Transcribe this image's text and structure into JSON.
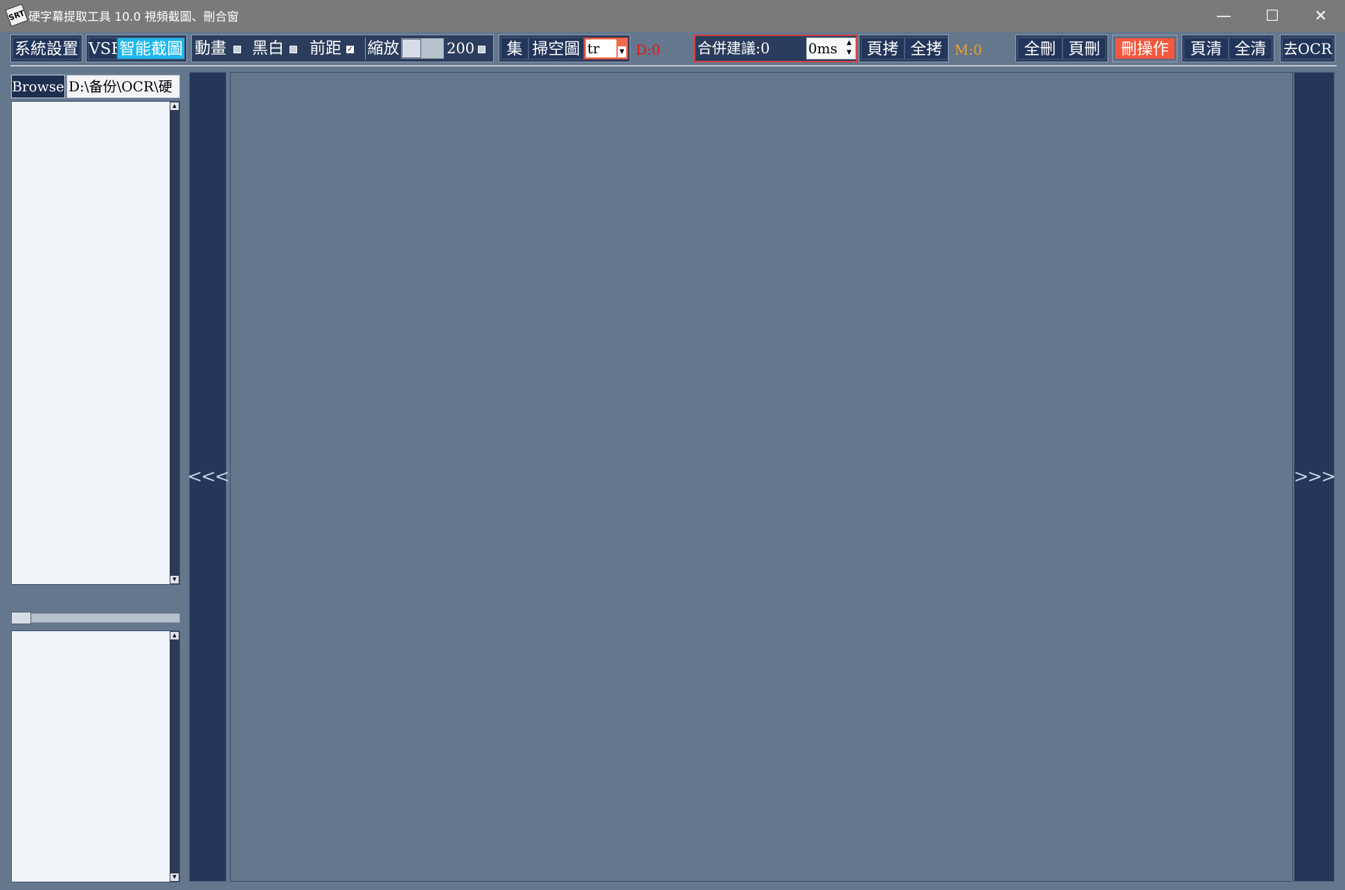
{
  "window": {
    "app_icon_text": "SRT",
    "title": "硬字幕提取工具 10.0   視頻截圖、刪合窗",
    "minimize": "—",
    "maximize": "☐",
    "close": "✕"
  },
  "toolbar": {
    "system_settings": "系統設置",
    "vsf": "VSF",
    "smart_crop": "智能截圖",
    "animation": "動畫",
    "animation_checked": false,
    "black_white": "黑白",
    "black_white_checked": false,
    "front_margin": "前距",
    "front_margin_checked": true,
    "zoom": "縮放",
    "zoom_value": "200",
    "zoom_checked": false,
    "collect": "集",
    "scan_empty": "掃空圖",
    "mode_select_value": "tr",
    "d_count": "D:0",
    "merge_suggestion": "合併建議:0",
    "ms_value": "0ms",
    "page_copy": "頁拷",
    "copy_all": "全拷",
    "m_count": "M:0",
    "delete_all": "全刪",
    "page_delete": "頁刪",
    "delete_ops": "刪操作",
    "page_clear": "頁清",
    "clear_all": "全清",
    "go_ocr": "去OCR"
  },
  "left_panel": {
    "browse": "Browse",
    "path": "D:\\备份\\OCR\\硬"
  },
  "nav": {
    "prev": "<<<",
    "next": ">>>"
  },
  "colors": {
    "background": "#65778c",
    "toolbar_button": "#22355a",
    "accent_blue": "#1eb8ec",
    "accent_red": "#f2593f",
    "d_count_color": "#e01818",
    "m_count_color": "#f0a020"
  }
}
